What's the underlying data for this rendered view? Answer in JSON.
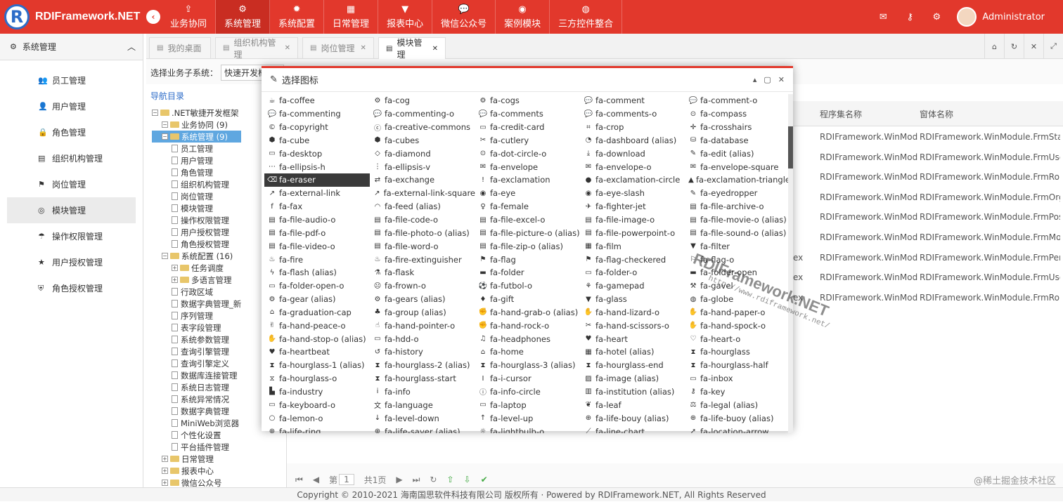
{
  "app": {
    "logo_text": "RDIFramework.NET"
  },
  "menu": [
    {
      "label": "业务协同",
      "icon": "share-icon"
    },
    {
      "label": "系统管理",
      "icon": "gears-icon",
      "active": true
    },
    {
      "label": "系统配置",
      "icon": "gear-icon"
    },
    {
      "label": "日常管理",
      "icon": "calendar-icon"
    },
    {
      "label": "报表中心",
      "icon": "filter-icon"
    },
    {
      "label": "微信公众号",
      "icon": "wechat-icon"
    },
    {
      "label": "案例模块",
      "icon": "eye-icon"
    },
    {
      "label": "三方控件整合",
      "icon": "globe-icon"
    }
  ],
  "user": {
    "name": "Administrator"
  },
  "sidebar": {
    "title": "系统管理",
    "items": [
      {
        "label": "员工管理",
        "glyph": "👥"
      },
      {
        "label": "用户管理",
        "glyph": "👤"
      },
      {
        "label": "角色管理",
        "glyph": "🔒"
      },
      {
        "label": "组织机构管理",
        "glyph": "▤"
      },
      {
        "label": "岗位管理",
        "glyph": "⚑"
      },
      {
        "label": "模块管理",
        "glyph": "◎",
        "active": true
      },
      {
        "label": "操作权限管理",
        "glyph": "☂"
      },
      {
        "label": "用户授权管理",
        "glyph": "★"
      },
      {
        "label": "角色授权管理",
        "glyph": "⛨"
      }
    ]
  },
  "tabs": [
    {
      "label": "我的桌面"
    },
    {
      "label": "组织机构管理"
    },
    {
      "label": "岗位管理"
    },
    {
      "label": "模块管理",
      "active": true
    }
  ],
  "content": {
    "subsystem_label": "选择业务子系统：",
    "subsystem_value": "快速开发框架",
    "nav_title": "导航目录",
    "tree": [
      {
        "label": ".NET敏捷开发框架",
        "level": 0,
        "type": "folder"
      },
      {
        "label": "业务协同 (9)",
        "level": 1,
        "type": "folder"
      },
      {
        "label": "系统管理 (9)",
        "level": 1,
        "type": "folder",
        "selected": true
      },
      {
        "label": "员工管理",
        "level": 2,
        "type": "file"
      },
      {
        "label": "用户管理",
        "level": 2,
        "type": "file"
      },
      {
        "label": "角色管理",
        "level": 2,
        "type": "file"
      },
      {
        "label": "组织机构管理",
        "level": 2,
        "type": "file"
      },
      {
        "label": "岗位管理",
        "level": 2,
        "type": "file"
      },
      {
        "label": "模块管理",
        "level": 2,
        "type": "file"
      },
      {
        "label": "操作权限管理",
        "level": 2,
        "type": "file"
      },
      {
        "label": "用户授权管理",
        "level": 2,
        "type": "file"
      },
      {
        "label": "角色授权管理",
        "level": 2,
        "type": "file"
      },
      {
        "label": "系统配置 (16)",
        "level": 1,
        "type": "folder"
      },
      {
        "label": "任务调度",
        "level": 2,
        "type": "folder"
      },
      {
        "label": "多语言管理",
        "level": 2,
        "type": "folder"
      },
      {
        "label": "行政区域",
        "level": 2,
        "type": "file"
      },
      {
        "label": "数据字典管理_新",
        "level": 2,
        "type": "file"
      },
      {
        "label": "序列管理",
        "level": 2,
        "type": "file"
      },
      {
        "label": "表字段管理",
        "level": 2,
        "type": "file"
      },
      {
        "label": "系统参数管理",
        "level": 2,
        "type": "file"
      },
      {
        "label": "查询引擎管理",
        "level": 2,
        "type": "file"
      },
      {
        "label": "查询引擎定义",
        "level": 2,
        "type": "file"
      },
      {
        "label": "数据库连接管理",
        "level": 2,
        "type": "file"
      },
      {
        "label": "系统日志管理",
        "level": 2,
        "type": "file"
      },
      {
        "label": "系统异常情况",
        "level": 2,
        "type": "file"
      },
      {
        "label": "数据字典管理",
        "level": 2,
        "type": "file"
      },
      {
        "label": "MiniWeb浏览器",
        "level": 2,
        "type": "file"
      },
      {
        "label": "个性化设置",
        "level": 2,
        "type": "file"
      },
      {
        "label": "平台插件管理",
        "level": 2,
        "type": "file"
      },
      {
        "label": "日常管理",
        "level": 1,
        "type": "folder"
      },
      {
        "label": "报表中心",
        "level": 1,
        "type": "folder"
      },
      {
        "label": "微信公众号",
        "level": 1,
        "type": "folder"
      }
    ],
    "grid_headers": [
      "程序集名称",
      "窗体名称"
    ],
    "grid_rows": [
      [
        "",
        "RDIFramework.WinModule",
        "RDIFramework.WinModule.FrmStaff"
      ],
      [
        "",
        "RDIFramework.WinModule",
        "RDIFramework.WinModule.FrmUser"
      ],
      [
        "",
        "RDIFramework.WinModule",
        "RDIFramework.WinModule.FrmRole"
      ],
      [
        "",
        "RDIFramework.WinModule",
        "RDIFramework.WinModule.FrmOrga"
      ],
      [
        "",
        "RDIFramework.WinModule",
        "RDIFramework.WinModule.FrmPost"
      ],
      [
        "",
        "RDIFramework.WinModule",
        "RDIFramework.WinModule.FrmMod"
      ],
      [
        "ex",
        "RDIFramework.WinModule",
        "RDIFramework.WinModule.FrmPerr"
      ],
      [
        "ex",
        "RDIFramework.WinModule",
        "RDIFramework.WinModule.FrmUser"
      ],
      [
        "ex",
        "RDIFramework.WinModule",
        "RDIFramework.WinModule.FrmRole"
      ]
    ],
    "pager": {
      "page_prefix": "第",
      "page_value": "1",
      "total": "共1页"
    }
  },
  "dialog": {
    "title": "选择图标",
    "icons": [
      [
        "☕",
        "fa-coffee"
      ],
      [
        "⚙",
        "fa-cog"
      ],
      [
        "⚙",
        "fa-cogs"
      ],
      [
        "💬",
        "fa-comment"
      ],
      [
        "💬",
        "fa-comment-o"
      ],
      [
        "💬",
        "fa-commenting"
      ],
      [
        "💬",
        "fa-commenting-o"
      ],
      [
        "💬",
        "fa-comments"
      ],
      [
        "💬",
        "fa-comments-o"
      ],
      [
        "⊙",
        "fa-compass"
      ],
      [
        "©",
        "fa-copyright"
      ],
      [
        "ⓒ",
        "fa-creative-commons"
      ],
      [
        "▭",
        "fa-credit-card"
      ],
      [
        "⌗",
        "fa-crop"
      ],
      [
        "✛",
        "fa-crosshairs"
      ],
      [
        "⬢",
        "fa-cube"
      ],
      [
        "⬢",
        "fa-cubes"
      ],
      [
        "✂",
        "fa-cutlery"
      ],
      [
        "◔",
        "fa-dashboard (alias)"
      ],
      [
        "⛁",
        "fa-database"
      ],
      [
        "▭",
        "fa-desktop"
      ],
      [
        "◇",
        "fa-diamond"
      ],
      [
        "⊙",
        "fa-dot-circle-o"
      ],
      [
        "⤓",
        "fa-download"
      ],
      [
        "✎",
        "fa-edit (alias)"
      ],
      [
        "⋯",
        "fa-ellipsis-h"
      ],
      [
        "⋮",
        "fa-ellipsis-v"
      ],
      [
        "✉",
        "fa-envelope"
      ],
      [
        "✉",
        "fa-envelope-o"
      ],
      [
        "✉",
        "fa-envelope-square"
      ],
      [
        "⌫",
        "fa-eraser"
      ],
      [
        "⇄",
        "fa-exchange"
      ],
      [
        "!",
        "fa-exclamation"
      ],
      [
        "●",
        "fa-exclamation-circle"
      ],
      [
        "▲",
        "fa-exclamation-triangle"
      ],
      [
        "↗",
        "fa-external-link"
      ],
      [
        "↗",
        "fa-external-link-square"
      ],
      [
        "◉",
        "fa-eye"
      ],
      [
        "◉",
        "fa-eye-slash"
      ],
      [
        "✎",
        "fa-eyedropper"
      ],
      [
        "f",
        "fa-fax"
      ],
      [
        "◠",
        "fa-feed (alias)"
      ],
      [
        "♀",
        "fa-female"
      ],
      [
        "✈",
        "fa-fighter-jet"
      ],
      [
        "▤",
        "fa-file-archive-o"
      ],
      [
        "▤",
        "fa-file-audio-o"
      ],
      [
        "▤",
        "fa-file-code-o"
      ],
      [
        "▤",
        "fa-file-excel-o"
      ],
      [
        "▤",
        "fa-file-image-o"
      ],
      [
        "▤",
        "fa-file-movie-o (alias)"
      ],
      [
        "▤",
        "fa-file-pdf-o"
      ],
      [
        "▤",
        "fa-file-photo-o (alias)"
      ],
      [
        "▤",
        "fa-file-picture-o (alias)"
      ],
      [
        "▤",
        "fa-file-powerpoint-o"
      ],
      [
        "▤",
        "fa-file-sound-o (alias)"
      ],
      [
        "▤",
        "fa-file-video-o"
      ],
      [
        "▤",
        "fa-file-word-o"
      ],
      [
        "▤",
        "fa-file-zip-o (alias)"
      ],
      [
        "▦",
        "fa-film"
      ],
      [
        "▼",
        "fa-filter"
      ],
      [
        "♨",
        "fa-fire"
      ],
      [
        "♨",
        "fa-fire-extinguisher"
      ],
      [
        "⚑",
        "fa-flag"
      ],
      [
        "⚑",
        "fa-flag-checkered"
      ],
      [
        "⚐",
        "fa-flag-o"
      ],
      [
        "ϟ",
        "fa-flash (alias)"
      ],
      [
        "⚗",
        "fa-flask"
      ],
      [
        "▬",
        "fa-folder"
      ],
      [
        "▭",
        "fa-folder-o"
      ],
      [
        "▬",
        "fa-folder-open"
      ],
      [
        "▭",
        "fa-folder-open-o"
      ],
      [
        "☹",
        "fa-frown-o"
      ],
      [
        "⚽",
        "fa-futbol-o"
      ],
      [
        "⚘",
        "fa-gamepad"
      ],
      [
        "⚒",
        "fa-gavel"
      ],
      [
        "⚙",
        "fa-gear (alias)"
      ],
      [
        "⚙",
        "fa-gears (alias)"
      ],
      [
        "♦",
        "fa-gift"
      ],
      [
        "▼",
        "fa-glass"
      ],
      [
        "◍",
        "fa-globe"
      ],
      [
        "⌂",
        "fa-graduation-cap"
      ],
      [
        "♣",
        "fa-group (alias)"
      ],
      [
        "✊",
        "fa-hand-grab-o (alias)"
      ],
      [
        "✋",
        "fa-hand-lizard-o"
      ],
      [
        "✋",
        "fa-hand-paper-o"
      ],
      [
        "✌",
        "fa-hand-peace-o"
      ],
      [
        "☝",
        "fa-hand-pointer-o"
      ],
      [
        "✊",
        "fa-hand-rock-o"
      ],
      [
        "✂",
        "fa-hand-scissors-o"
      ],
      [
        "✋",
        "fa-hand-spock-o"
      ],
      [
        "✋",
        "fa-hand-stop-o (alias)"
      ],
      [
        "▭",
        "fa-hdd-o"
      ],
      [
        "♫",
        "fa-headphones"
      ],
      [
        "♥",
        "fa-heart"
      ],
      [
        "♡",
        "fa-heart-o"
      ],
      [
        "♥",
        "fa-heartbeat"
      ],
      [
        "↺",
        "fa-history"
      ],
      [
        "⌂",
        "fa-home"
      ],
      [
        "▦",
        "fa-hotel (alias)"
      ],
      [
        "⧗",
        "fa-hourglass"
      ],
      [
        "⧗",
        "fa-hourglass-1 (alias)"
      ],
      [
        "⧗",
        "fa-hourglass-2 (alias)"
      ],
      [
        "⧗",
        "fa-hourglass-3 (alias)"
      ],
      [
        "⧗",
        "fa-hourglass-end"
      ],
      [
        "⧗",
        "fa-hourglass-half"
      ],
      [
        "⧖",
        "fa-hourglass-o"
      ],
      [
        "⧗",
        "fa-hourglass-start"
      ],
      [
        "I",
        "fa-i-cursor"
      ],
      [
        "▨",
        "fa-image (alias)"
      ],
      [
        "▭",
        "fa-inbox"
      ],
      [
        "▙",
        "fa-industry"
      ],
      [
        "i",
        "fa-info"
      ],
      [
        "ⓘ",
        "fa-info-circle"
      ],
      [
        "▥",
        "fa-institution (alias)"
      ],
      [
        "⚷",
        "fa-key"
      ],
      [
        "▭",
        "fa-keyboard-o"
      ],
      [
        "文",
        "fa-language"
      ],
      [
        "▭",
        "fa-laptop"
      ],
      [
        "❦",
        "fa-leaf"
      ],
      [
        "⚖",
        "fa-legal (alias)"
      ],
      [
        "○",
        "fa-lemon-o"
      ],
      [
        "↓",
        "fa-level-down"
      ],
      [
        "↑",
        "fa-level-up"
      ],
      [
        "⊕",
        "fa-life-bouy (alias)"
      ],
      [
        "⊕",
        "fa-life-buoy (alias)"
      ],
      [
        "⊕",
        "fa-life-ring"
      ],
      [
        "⊕",
        "fa-life-saver (alias)"
      ],
      [
        "☼",
        "fa-lightbulb-o"
      ],
      [
        "⟋",
        "fa-line-chart"
      ],
      [
        "➚",
        "fa-location-arrow"
      ]
    ]
  },
  "watermark": {
    "title": "RDIFramework.NET",
    "url": "http://www.rdiframework.net/"
  },
  "watermark2": "@稀土掘金技术社区",
  "footer": "Copyright © 2010-2021 海南国思软件科技有限公司 版权所有 · Powered by RDIFramework.NET, All Rights Reserved"
}
